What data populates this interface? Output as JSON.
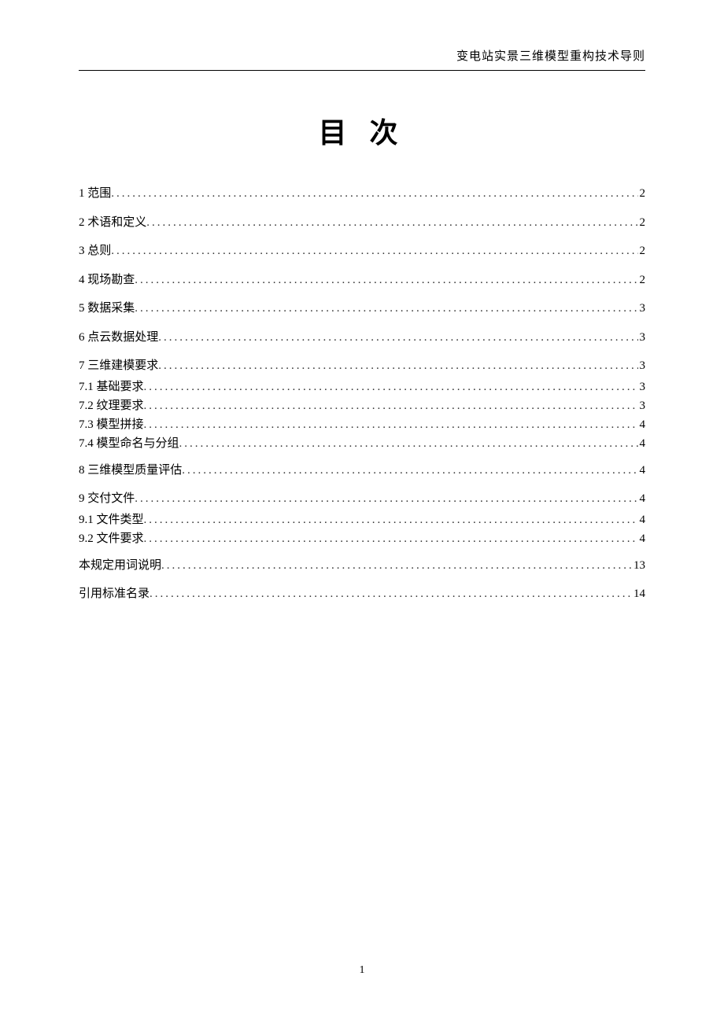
{
  "header": {
    "running_title": "变电站实景三维模型重构技术导则"
  },
  "title": "目 次",
  "toc": [
    {
      "label": "1 范围",
      "page": "2",
      "level": "main"
    },
    {
      "label": "2 术语和定义",
      "page": "2",
      "level": "main"
    },
    {
      "label": "3 总则",
      "page": "2",
      "level": "main"
    },
    {
      "label": "4 现场勘查",
      "page": "2",
      "level": "main"
    },
    {
      "label": "5 数据采集",
      "page": "3",
      "level": "main"
    },
    {
      "label": "6 点云数据处理",
      "page": "3",
      "level": "main"
    },
    {
      "label": "7 三维建模要求",
      "page": "3",
      "level": "main"
    },
    {
      "label": "7.1 基础要求",
      "page": "3",
      "level": "sub"
    },
    {
      "label": "7.2 纹理要求",
      "page": "3",
      "level": "sub"
    },
    {
      "label": "7.3 模型拼接",
      "page": "4",
      "level": "sub"
    },
    {
      "label": "7.4 模型命名与分组",
      "page": "4",
      "level": "sub"
    },
    {
      "label": "8 三维模型质量评估",
      "page": "4",
      "level": "main"
    },
    {
      "label": "9 交付文件",
      "page": "4",
      "level": "main"
    },
    {
      "label": "9.1 文件类型",
      "page": "4",
      "level": "sub"
    },
    {
      "label": "9.2 文件要求",
      "page": "4",
      "level": "sub"
    },
    {
      "label": "本规定用词说明",
      "page": "13",
      "level": "main"
    },
    {
      "label": "引用标准名录",
      "page": "14",
      "level": "main"
    }
  ],
  "page_number": "1"
}
